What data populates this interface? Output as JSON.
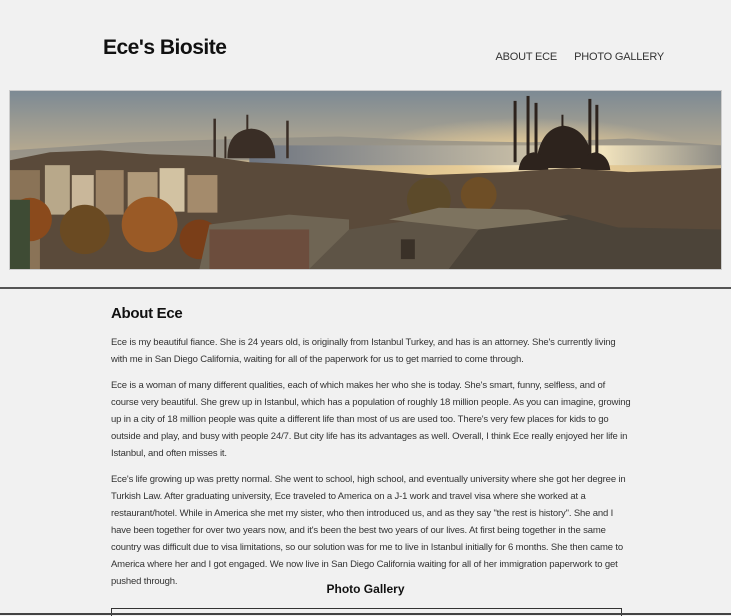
{
  "header": {
    "site_title": "Ece's Biosite",
    "nav": [
      {
        "label": "ABOUT ECE"
      },
      {
        "label": "PHOTO GALLERY"
      }
    ]
  },
  "about": {
    "heading": "About Ece",
    "paragraphs": [
      "Ece is my beautiful fiance. She is 24 years old, is originally from Istanbul Turkey, and has is an attorney. She's currently living with me in San Diego California, waiting for all of the paperwork for us to get married to come through.",
      "Ece is a woman of many different qualities, each of which makes her who she is today. She's smart, funny, selfless, and of course very beautiful. She grew up in Istanbul, which has a population of roughly 18 million people. As you can imagine, growing up in a city of 18 million people was quite a different life than most of us are used too. There's very few places for kids to go outside and play, and busy with people 24/7. But city life has its advantages as well. Overall, I think Ece really enjoyed her life in Istanbul, and often misses it.",
      "Ece's life growing up was pretty normal. She went to school, high school, and eventually university where she got her degree in Turkish Law. After graduating university, Ece traveled to America on a J-1 work and travel visa where she worked at a restaurant/hotel. While in America she met my sister, who then introduced us, and as they say \"the rest is history\". She and I have been together for over two years now, and it's been the best two years of our lives. At first being together in the same country was difficult due to visa limitations, so our solution was for me to live in Istanbul initially for 6 months. She then came to America where her and I got engaged. We now live in San Diego California waiting for all of her immigration paperwork to get pushed through."
    ]
  },
  "gallery": {
    "heading": "Photo Gallery"
  }
}
